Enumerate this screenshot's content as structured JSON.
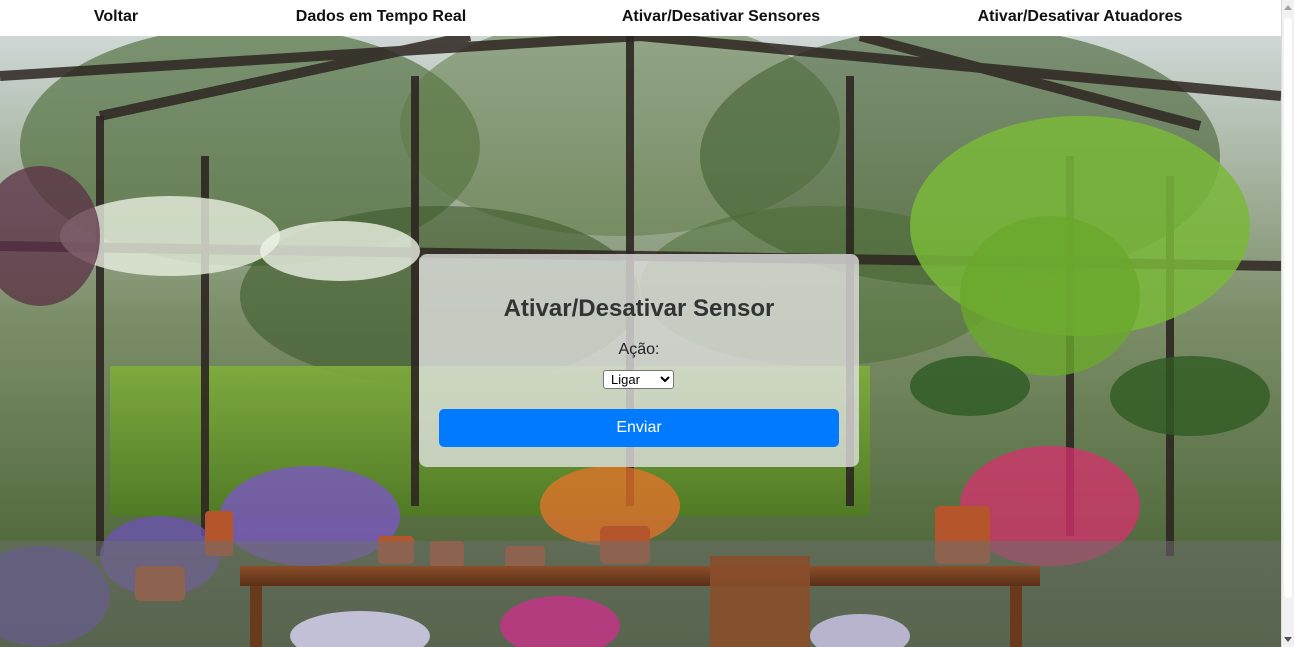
{
  "nav": {
    "items": [
      {
        "label": "Voltar"
      },
      {
        "label": "Dados em Tempo Real"
      },
      {
        "label": "Ativar/Desativar Sensores"
      },
      {
        "label": "Ativar/Desativar Atuadores"
      }
    ]
  },
  "form": {
    "title": "Ativar/Desativar Sensor",
    "action_label": "Ação:",
    "action_selected": "Ligar",
    "submit_label": "Enviar"
  },
  "colors": {
    "primary_button": "#007bff",
    "nav_background": "#ffffff"
  }
}
